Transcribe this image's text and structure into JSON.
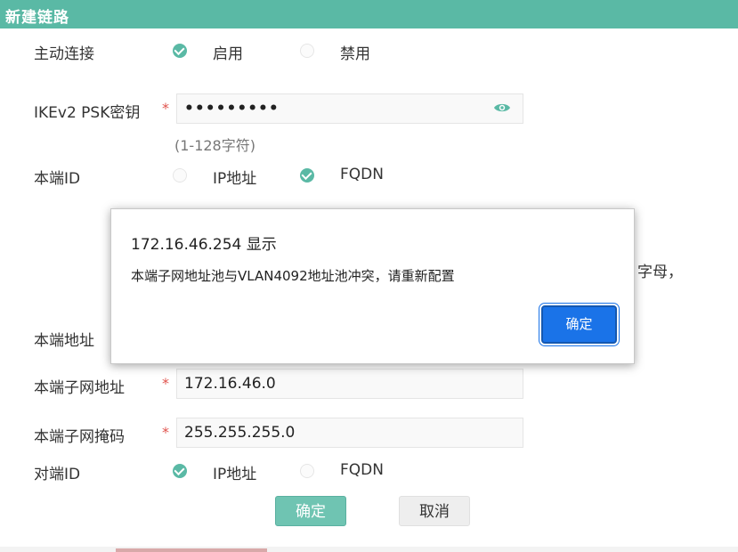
{
  "window": {
    "title": "新建链路"
  },
  "form": {
    "active_connect": {
      "label": "主动连接",
      "opt_on": "启用",
      "opt_off": "禁用",
      "selected": "启用"
    },
    "psk": {
      "label": "IKEv2 PSK密钥",
      "required_mark": "*",
      "value": "•••••••••",
      "hint": "(1-128字符)"
    },
    "local_id": {
      "label": "本端ID",
      "opt_ip": "IP地址",
      "opt_fqdn": "FQDN",
      "selected": "FQDN"
    },
    "hidden_hint_fragment": "字母，",
    "local_addr": {
      "label": "本端地址"
    },
    "local_subnet": {
      "label": "本端子网地址",
      "required_mark": "*",
      "value": "172.16.46.0"
    },
    "local_mask": {
      "label": "本端子网掩码",
      "required_mark": "*",
      "value": "255.255.255.0"
    },
    "peer_id": {
      "label": "对端ID",
      "opt_ip": "IP地址",
      "opt_fqdn": "FQDN",
      "selected": "IP地址"
    }
  },
  "footer": {
    "ok_label": "确定",
    "cancel_label": "取消"
  },
  "alert": {
    "origin": "172.16.46.254 显示",
    "message": "本端子网地址池与VLAN4092地址池冲突，请重新配置",
    "ok_label": "确定"
  },
  "colors": {
    "accent": "#5ab9a5",
    "dialog_button": "#1a73e8",
    "required": "#e0544e"
  },
  "icons": {
    "password_toggle": "eye-icon"
  }
}
